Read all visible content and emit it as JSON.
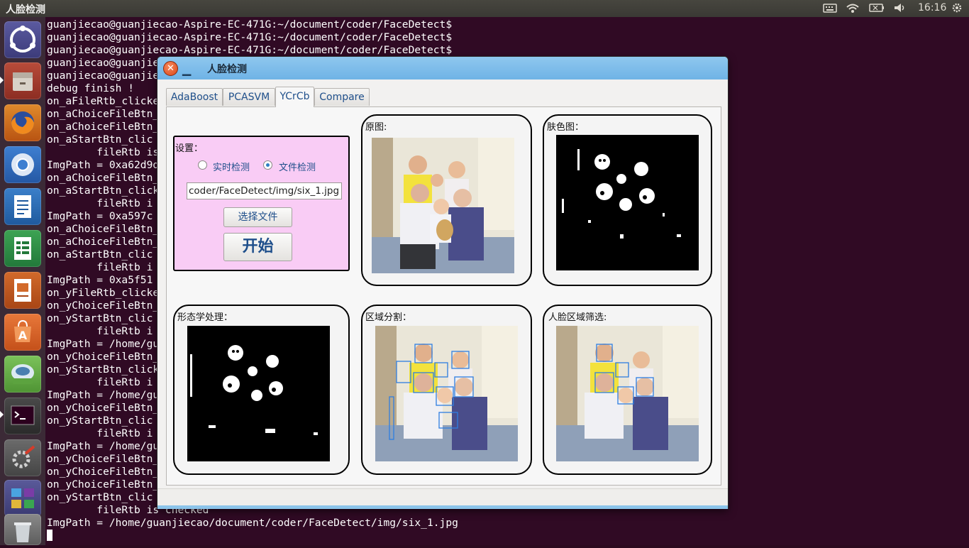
{
  "topbar": {
    "app_title": "人脸检测",
    "clock": "16:16",
    "indicators": [
      "keyboard-icon",
      "wifi-icon",
      "battery-icon",
      "volume-icon",
      "settings-gear-icon"
    ]
  },
  "launcher": {
    "items": [
      "ubuntu-dash-icon",
      "files-icon",
      "firefox-icon",
      "chromium-icon",
      "writer-icon",
      "calc-icon",
      "impress-icon",
      "software-center-icon",
      "backup-icon",
      "terminal-icon",
      "system-settings-icon",
      "workspace-switcher-icon",
      "trash-icon"
    ]
  },
  "terminal": {
    "lines": [
      "guanjiecao@guanjiecao-Aspire-EC-471G:~/document/coder/FaceDetect$",
      "guanjiecao@guanjiecao-Aspire-EC-471G:~/document/coder/FaceDetect$",
      "guanjiecao@guanjiecao-Aspire-EC-471G:~/document/coder/FaceDetect$",
      "guanjiecao@guanjiec",
      "guanjiecao@guanjiec",
      "debug finish !",
      "on_aFileRtb_clicke",
      "on_aChoiceFileBtn_",
      "on_aChoiceFileBtn_",
      "on_aStartBtn_clic",
      "        fileRtb is",
      "ImgPath = 0xa62d9d",
      "on_aChoiceFileBtn_",
      "on_aStartBtn_click",
      "        fileRtb i",
      "ImgPath = 0xa597c",
      "on_aChoiceFileBtn_",
      "on_aChoiceFileBtn_",
      "on_aStartBtn_clic",
      "        fileRtb i",
      "ImgPath = 0xa5f51",
      "on_yFileRtb_clicke",
      "on_yChoiceFileBtn_",
      "on_yStartBtn_clic",
      "        fileRtb i",
      "ImgPath = /home/gu",
      "on_yChoiceFileBtn_",
      "on_yStartBtn_click",
      "        fileRtb i",
      "ImgPath = /home/gu",
      "on_yChoiceFileBtn_",
      "on_yStartBtn_clic",
      "        fileRtb i",
      "ImgPath = /home/gu",
      "on_yChoiceFileBtn_",
      "on_yChoiceFileBtn_",
      "on_yChoiceFileBtn_",
      "on_yStartBtn_clic",
      "        fileRtb is checked",
      "ImgPath = /home/guanjiecao/document/coder/FaceDetect/img/six_1.jpg"
    ]
  },
  "window": {
    "title": "人脸检测",
    "tabs": [
      "AdaBoost",
      "PCASVM",
      "YCrCb",
      "Compare"
    ],
    "active_tab": "YCrCb",
    "settings": {
      "title": "设置：",
      "radio_realtime": "实时检测",
      "radio_file": "文件检测",
      "selected_mode": "文件检测",
      "path_value": "coder/FaceDetect/img/six_1.jpg",
      "choose_file_label": "选择文件",
      "start_label": "开始"
    },
    "panels": {
      "original": "原图:",
      "skin": "肤色图：",
      "morph": "形态学处理：",
      "region": "区域分割：",
      "face": "人脸区域筛选:"
    }
  }
}
